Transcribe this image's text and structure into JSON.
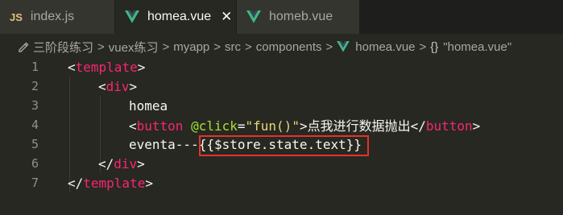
{
  "tabs": [
    {
      "icon": "JS",
      "label": "index.js",
      "active": false
    },
    {
      "icon": "vue-icon",
      "label": "homea.vue",
      "active": true,
      "close": "✕"
    },
    {
      "icon": "vue-icon",
      "label": "homeb.vue",
      "active": false
    }
  ],
  "breadcrumb": {
    "items": [
      "三阶段练习",
      "vuex练习",
      "myapp",
      "src",
      "components",
      "homea.vue"
    ],
    "separator": ">",
    "symbol_prefix": "{}",
    "symbol": "\"homea.vue\""
  },
  "editor": {
    "line_numbers": [
      "1",
      "2",
      "3",
      "4",
      "5",
      "6",
      "7"
    ],
    "lines": {
      "l1": {
        "open": "<",
        "tag": "template",
        "close": ">"
      },
      "l2": {
        "open": "<",
        "tag": "div",
        "close": ">"
      },
      "l3": {
        "text": "homea"
      },
      "l4": {
        "open": "<",
        "tag": "button",
        "space": " ",
        "attr": "@click",
        "eq": "=",
        "value": "\"fun()\"",
        "close": ">",
        "text": "点我进行数据抛出",
        "end_open": "</",
        "end_tag": "button",
        "end_close": ">"
      },
      "l5": {
        "text": "eventa---",
        "expr": "{{$store.state.text}}"
      },
      "l6": {
        "open": "</",
        "tag": "div",
        "close": ">"
      },
      "l7": {
        "open": "</",
        "tag": "template",
        "close": ">"
      }
    }
  },
  "colors": {
    "background": "#272822",
    "tab_inactive": "#34352f",
    "tag": "#f92672",
    "attribute": "#a6e22e",
    "string": "#e6db74",
    "highlight_border": "#e5322b",
    "vue_green": "#41b883"
  }
}
